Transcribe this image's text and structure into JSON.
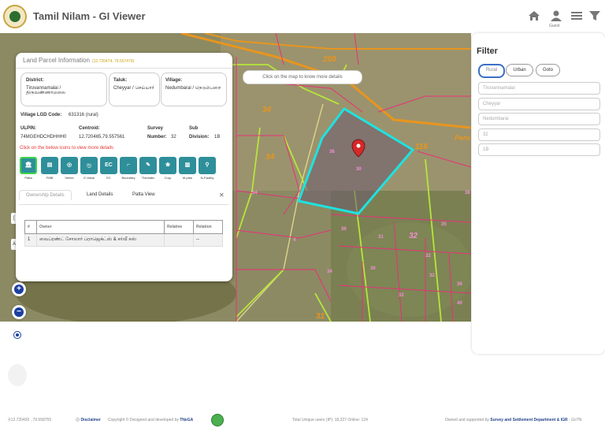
{
  "header": {
    "title": "Tamil Nilam - GI Viewer",
    "guest_label": "Guest",
    "icons": [
      "home-icon",
      "user-icon",
      "menu-icon",
      "filter-icon"
    ]
  },
  "map": {
    "hint": "Click on the map to know more details",
    "road_labels": [
      "208",
      "34",
      "34",
      "116",
      "31",
      "32"
    ],
    "place_label": "Peru",
    "pink_labels": [
      "36",
      "30",
      "31",
      "32",
      "32",
      "32",
      "36",
      "34",
      "4",
      "30",
      "34",
      "35",
      "36",
      "38",
      "40"
    ]
  },
  "land_parcel": {
    "title": "Land Parcel Information",
    "coords": "(12.720474, 79.557479)",
    "district_label": "District:",
    "district_value": "Tiruvannamalai / திருவண்ணாமலை",
    "taluk_label": "Taluk:",
    "taluk_value": "Cheyyar / செய்யார்",
    "village_label": "Village:",
    "village_value": "Nedumbarai / நெடும்பறை",
    "lgd_label": "Village LGD Code:",
    "lgd_value": "631316 (rural)",
    "ulpin_label": "ULPIN:",
    "ulpin_value": "74MGEHDCHDHHH0",
    "centroid_label": "Centroid:",
    "centroid_value": "12.720465,79.557561",
    "survey_label": "Survey",
    "survey_number_label": "Number:",
    "survey_value": "32",
    "sub_label": "Sub",
    "sub_division_label": "Division:",
    "sub_value": "1B",
    "note": "Click on the below icons to view more details",
    "icons": [
      {
        "text": "🏛",
        "caption": "Patta"
      },
      {
        "text": "▤",
        "caption": "FMB"
      },
      {
        "text": "◎",
        "caption": "Vertex"
      },
      {
        "text": "ரூ",
        "caption": "G Value"
      },
      {
        "text": "EC",
        "caption": "EC"
      },
      {
        "text": "⌐",
        "caption": "Boundary"
      },
      {
        "text": "✎",
        "caption": "Thematic"
      },
      {
        "text": "❀",
        "caption": "Crop"
      },
      {
        "text": "▥",
        "caption": "M-plan"
      },
      {
        "text": "⚲",
        "caption": "N-Facility"
      }
    ],
    "tabs": [
      "Ownership Details",
      "Land Details",
      "Patta View"
    ],
    "table": {
      "headers": [
        "#",
        "Owner",
        "Relative",
        "Relation"
      ],
      "rows": [
        [
          "1",
          "வைப்ரண்ட் சோலார் ப்ராஜெக்ட்ஸ் & சர்வீ சஸ்",
          "",
          "--"
        ]
      ]
    }
  },
  "filter": {
    "title": "Filter",
    "pills": [
      "Rural",
      "Urban",
      "Goto"
    ],
    "inputs": [
      "Tiruvannamalai",
      "Cheyyar",
      "Nedumbarai",
      "32",
      "1B"
    ]
  },
  "footer": {
    "coords": "12.720420 , 79.558755",
    "disclaimer": "Disclaimer",
    "copyright": "Copyright © Designed and developed by",
    "tnega": "TNeGA",
    "stats": "Total Unique users (IP): 18,227 Online: 124",
    "owned_prefix": "Owned and supported by",
    "owner_org": "Survey and Settlement Department & IGR",
    "owned_suffix": "- GoTN"
  },
  "colors": {
    "accent": "#2e8f9a",
    "selected_parcel": "#1fe2e0",
    "parcel_border": "#e8307a",
    "road": "#e8951e",
    "boundary": "#b6e63a"
  }
}
